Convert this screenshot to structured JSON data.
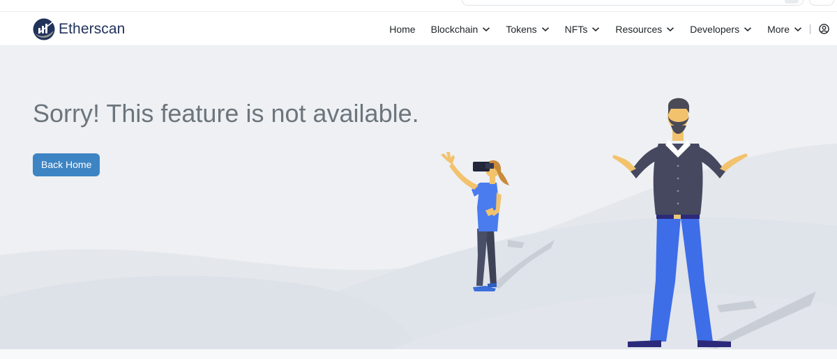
{
  "brand": {
    "name": "Etherscan",
    "logo_icon": "etherscan-logo-icon"
  },
  "nav": {
    "items": [
      {
        "label": "Home",
        "has_dropdown": false
      },
      {
        "label": "Blockchain",
        "has_dropdown": true
      },
      {
        "label": "Tokens",
        "has_dropdown": true
      },
      {
        "label": "NFTs",
        "has_dropdown": true
      },
      {
        "label": "Resources",
        "has_dropdown": true
      },
      {
        "label": "Developers",
        "has_dropdown": true
      },
      {
        "label": "More",
        "has_dropdown": true
      }
    ],
    "user_icon": "user-circle-icon"
  },
  "hero": {
    "title": "Sorry! This feature is not available.",
    "button_label": "Back Home"
  },
  "colors": {
    "brand": "#21325b",
    "button": "#3d84c4",
    "hero_bg": "#eef0f3",
    "title_text": "#6c757d"
  }
}
